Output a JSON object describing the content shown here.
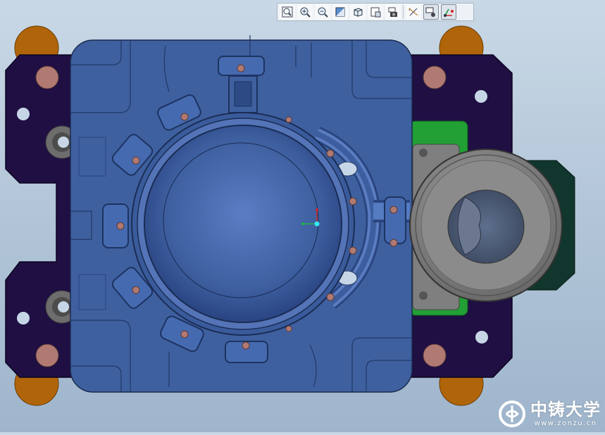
{
  "toolbar": {
    "buttons": [
      {
        "icon": "zoom-fit-icon",
        "active": false
      },
      {
        "icon": "zoom-in-icon",
        "active": false
      },
      {
        "icon": "zoom-out-icon",
        "active": false
      },
      {
        "icon": "repaint-icon",
        "active": false
      },
      {
        "icon": "display-style-cube-icon",
        "active": false
      },
      {
        "icon": "saved-views-icon",
        "active": false
      },
      {
        "icon": "view-manager-camera-icon",
        "active": false
      },
      {
        "icon": "datum-display-icon",
        "active": false
      },
      {
        "icon": "annotation-display-icon",
        "active": true
      },
      {
        "icon": "csys-display-icon",
        "active": true
      }
    ]
  },
  "watermark": {
    "logo": "zhongzhu-logo",
    "name": "中铸大学",
    "url": "www.zonzu.cn"
  },
  "colors": {
    "background_top": "#c9d8e6",
    "background_bottom": "#9fb5cc",
    "clamp_plate": "#1f0f43",
    "mold_plate": "#3f609f",
    "mold_plate_dark": "#2c477e",
    "orange_lug": "#b0650a",
    "bolt_head": "#b07a72",
    "green_block": "#22a035",
    "gray_disc": "#888888",
    "dark_teal_block": "#10362d"
  }
}
